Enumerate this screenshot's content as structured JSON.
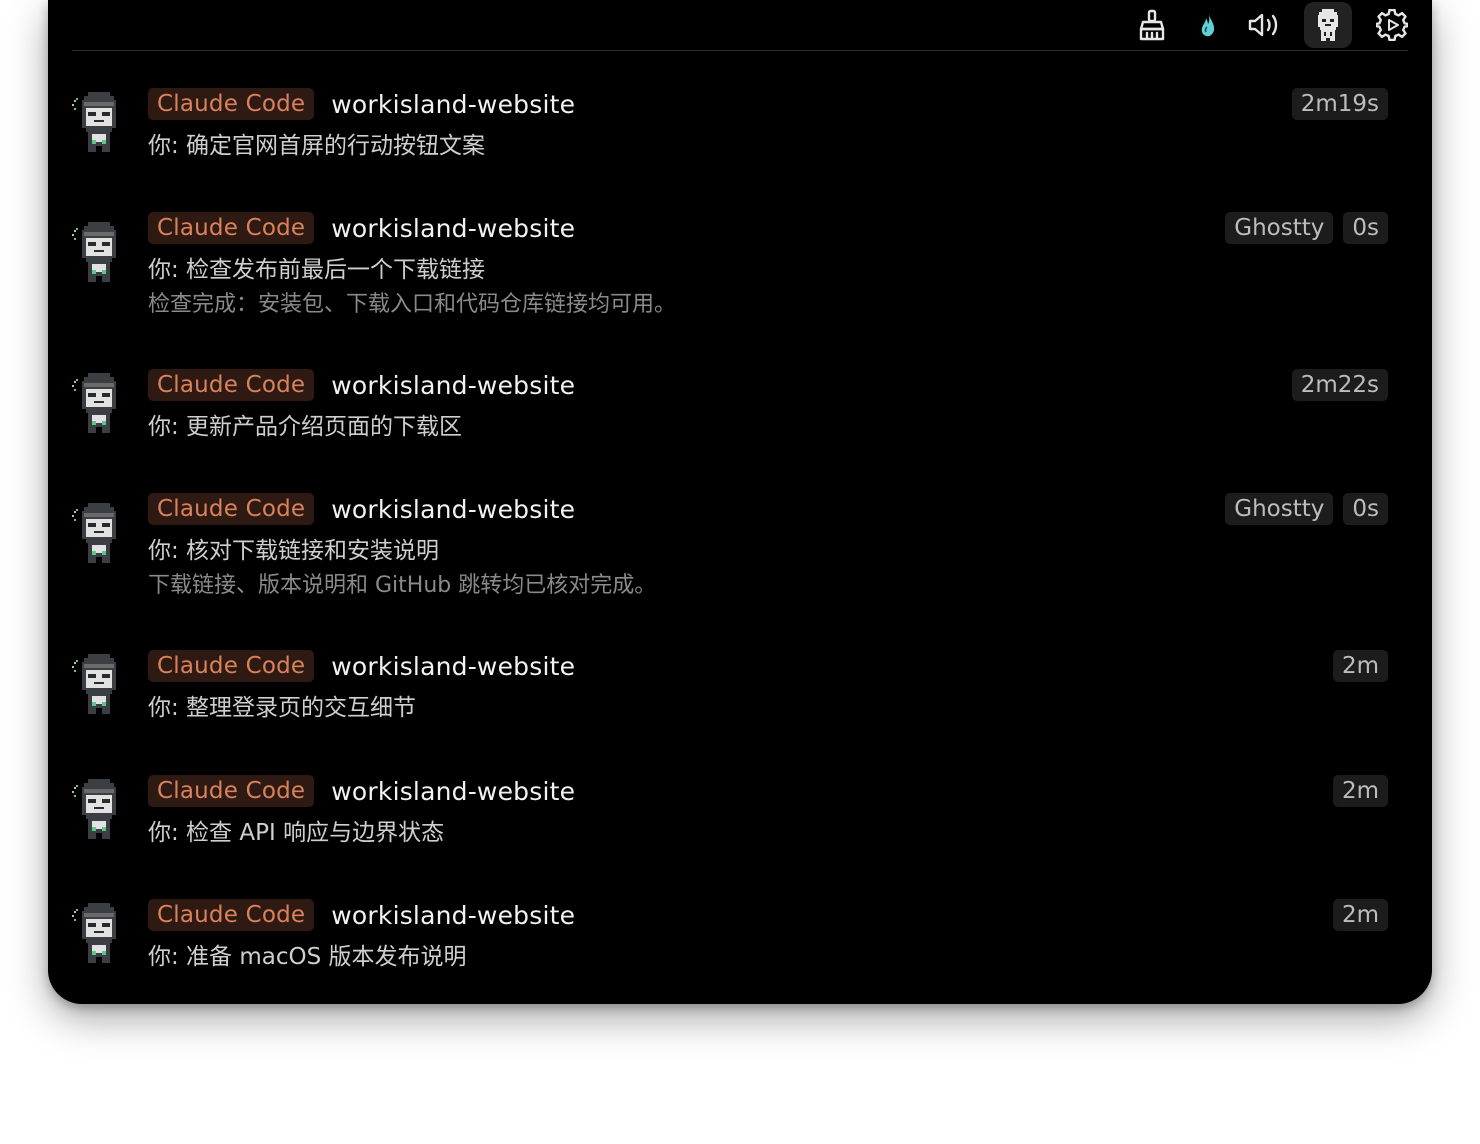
{
  "toolbar": {
    "icons": [
      {
        "name": "broom-icon",
        "color": "#e6e6e6"
      },
      {
        "name": "droplet-icon",
        "color": "#5ed0d6"
      },
      {
        "name": "speaker-icon",
        "color": "#e6e6e6"
      },
      {
        "name": "mascot-icon",
        "color": "#e6e6e6",
        "active": true
      },
      {
        "name": "gear-icon",
        "color": "#e6e6e6"
      }
    ]
  },
  "colors": {
    "agent_badge_bg": "#2e1a12",
    "agent_badge_text": "#d9825b",
    "pill_bg": "#1c1c1c"
  },
  "sessions": [
    {
      "agent": "Claude Code",
      "project": "workisland-website",
      "terminal": "",
      "time": "2m19s",
      "message": "你: 确定官网首屏的行动按钮文案",
      "reply": ""
    },
    {
      "agent": "Claude Code",
      "project": "workisland-website",
      "terminal": "Ghostty",
      "time": "0s",
      "message": "你: 检查发布前最后一个下载链接",
      "reply": "检查完成：安装包、下载入口和代码仓库链接均可用。"
    },
    {
      "agent": "Claude Code",
      "project": "workisland-website",
      "terminal": "",
      "time": "2m22s",
      "message": "你: 更新产品介绍页面的下载区",
      "reply": ""
    },
    {
      "agent": "Claude Code",
      "project": "workisland-website",
      "terminal": "Ghostty",
      "time": "0s",
      "message": "你: 核对下载链接和安装说明",
      "reply": "下载链接、版本说明和 GitHub 跳转均已核对完成。"
    },
    {
      "agent": "Claude Code",
      "project": "workisland-website",
      "terminal": "",
      "time": "2m",
      "message": "你: 整理登录页的交互细节",
      "reply": ""
    },
    {
      "agent": "Claude Code",
      "project": "workisland-website",
      "terminal": "",
      "time": "2m",
      "message": "你: 检查 API 响应与边界状态",
      "reply": ""
    },
    {
      "agent": "Claude Code",
      "project": "workisland-website",
      "terminal": "",
      "time": "2m",
      "message": "你: 准备 macOS 版本发布说明",
      "reply": ""
    }
  ]
}
